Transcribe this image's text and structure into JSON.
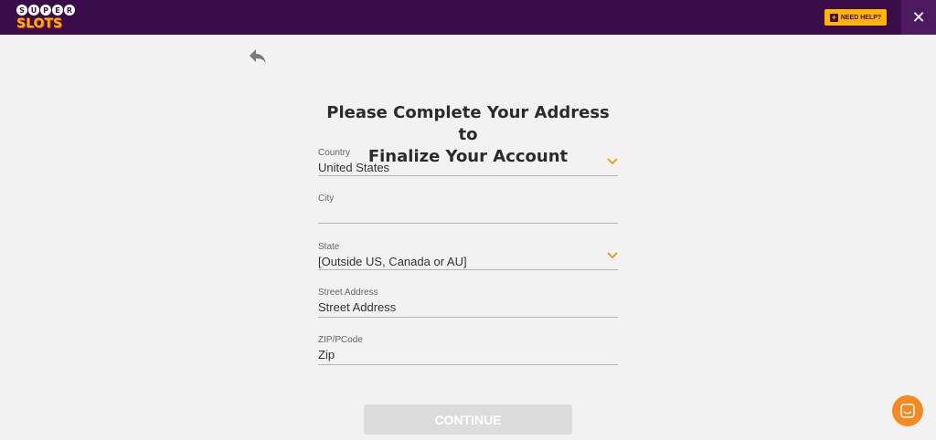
{
  "header": {
    "logo_top": [
      "S",
      "U",
      "P",
      "E",
      "R"
    ],
    "logo_bottom": "SLOTS",
    "help_label": "NEED HELP?",
    "close_glyph": "✕"
  },
  "form": {
    "title_line1": "Please Complete Your Address to",
    "title_line2": "Finalize Your Account",
    "country": {
      "label": "Country",
      "value": "United States"
    },
    "city": {
      "label": "City",
      "value": ""
    },
    "state": {
      "label": "State",
      "value": "[Outside US, Canada or AU]"
    },
    "street": {
      "label": "Street Address",
      "placeholder": "Street Address"
    },
    "zip": {
      "label": "ZIP/PCode",
      "placeholder": "Zip"
    },
    "continue_label": "CONTINUE"
  },
  "colors": {
    "header_bg": "#3a0d4a",
    "accent": "#ffb400",
    "chevron": "#f0a020",
    "chat": "#f68a1e"
  }
}
